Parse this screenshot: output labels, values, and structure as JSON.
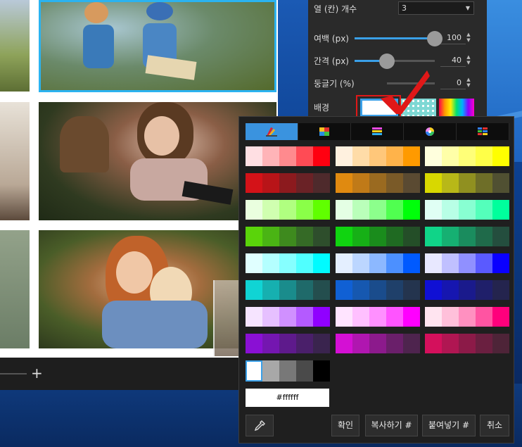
{
  "panel": {
    "columns": {
      "label": "열 (칸) 개수",
      "value": "3"
    },
    "margin": {
      "label": "여백 (px)",
      "value": "100",
      "fraction": 1.0
    },
    "spacing": {
      "label": "간격 (px)",
      "value": "40",
      "fraction": 0.4
    },
    "rounding": {
      "label": "둥글기 (%)",
      "value": "0",
      "fraction": 0.0
    },
    "background": {
      "label": "배경"
    }
  },
  "canvas_bar": {
    "plus_glyph": "+"
  },
  "picker": {
    "tabs": [
      {
        "icon": "swatch-fan-icon",
        "active": true
      },
      {
        "icon": "palette-grid-icon",
        "active": false
      },
      {
        "icon": "gradient-bars-icon",
        "active": false
      },
      {
        "icon": "color-wheel-icon",
        "active": false
      },
      {
        "icon": "color-list-icon",
        "active": false
      }
    ],
    "palettes": [
      [
        "#ffdfe3",
        "#ffb4b8",
        "#ff8a8e",
        "#ff4b55",
        "#ff0010"
      ],
      [
        "#fff1df",
        "#ffdca8",
        "#ffc77a",
        "#ffb34a",
        "#ff9a00"
      ],
      [
        "#ffffdd",
        "#ffffa8",
        "#ffff78",
        "#ffff48",
        "#ffff00"
      ],
      [
        "#d41218",
        "#b81418",
        "#8c1a1e",
        "#6a2226",
        "#4e2a2c"
      ],
      [
        "#e08a10",
        "#c07a18",
        "#9a6a20",
        "#7a5a28",
        "#5a4a32"
      ],
      [
        "#d8d800",
        "#b8b818",
        "#909020",
        "#6e6e28",
        "#505032"
      ],
      [
        "#eaffdf",
        "#d0ffb0",
        "#b0ff80",
        "#8aff48",
        "#60ff00"
      ],
      [
        "#e4ffe4",
        "#baffba",
        "#8cff8c",
        "#50ff50",
        "#00ff0a"
      ],
      [
        "#e0fff4",
        "#b8ffe6",
        "#88ffd2",
        "#54ffbb",
        "#00ff9c"
      ],
      [
        "#5ad40a",
        "#4ab414",
        "#3e8a1e",
        "#356a26",
        "#2e4e2c"
      ],
      [
        "#10d410",
        "#16b016",
        "#1a8c1c",
        "#1f6a22",
        "#244e28"
      ],
      [
        "#10d488",
        "#16b072",
        "#1a8c5e",
        "#1f6a4a",
        "#244e3e"
      ],
      [
        "#e0ffff",
        "#b4ffff",
        "#86ffff",
        "#50ffff",
        "#00fbff"
      ],
      [
        "#e4efff",
        "#bcd6ff",
        "#8cb8ff",
        "#4c90ff",
        "#005aff"
      ],
      [
        "#e8e8ff",
        "#c0c0ff",
        "#9090ff",
        "#5a5aff",
        "#0a00ff"
      ],
      [
        "#10d4d4",
        "#16b0b0",
        "#1a8c8c",
        "#1f6a6a",
        "#244e4e"
      ],
      [
        "#1060d4",
        "#1658b0",
        "#1a4c8c",
        "#1f406a",
        "#24344e"
      ],
      [
        "#1010d4",
        "#1616b0",
        "#1a1a8c",
        "#1f1f6a",
        "#24244e"
      ],
      [
        "#f6e4ff",
        "#e6c0ff",
        "#d090ff",
        "#b45aff",
        "#9000ff"
      ],
      [
        "#ffe4ff",
        "#ffc0ff",
        "#ff90ff",
        "#ff54ff",
        "#ff00ff"
      ],
      [
        "#ffe4f0",
        "#ffc0da",
        "#ff90c0",
        "#ff54a2",
        "#ff007c"
      ],
      [
        "#8a10d4",
        "#7416b0",
        "#5e1a8c",
        "#4a1f6a",
        "#3a244e"
      ],
      [
        "#d410d4",
        "#b016b0",
        "#8c1a8c",
        "#6a1f6a",
        "#4e244e"
      ],
      [
        "#d4105c",
        "#b01652",
        "#8c1a48",
        "#6a1f40",
        "#4e2438"
      ]
    ],
    "grays": [
      "#ffffff",
      "#a8a8a8",
      "#787878",
      "#4a4a4a",
      "#000000"
    ],
    "hex_value": "#ffffff",
    "buttons": {
      "eyedropper_icon": "eyedropper-icon",
      "ok": "확인",
      "copy": "복사하기 #",
      "paste": "붙여넣기 #",
      "cancel": "취소"
    }
  },
  "colors": {
    "accent": "#3aa0e8",
    "highlight_red": "#e01818",
    "panel_bg": "#2a2a2a",
    "picker_bg": "#1f1f1f"
  }
}
